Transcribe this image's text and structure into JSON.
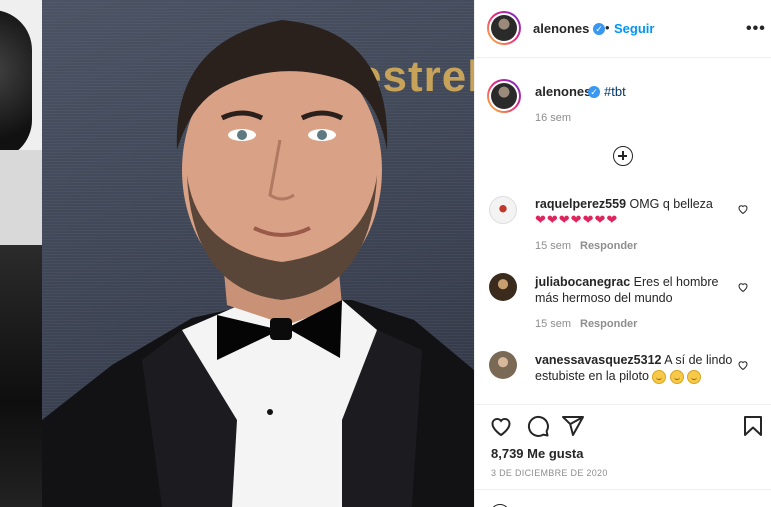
{
  "post": {
    "author": "alenones",
    "follow_label": "Seguir",
    "more_label": "•••",
    "caption_tag": "#tbt",
    "caption_age": "16 sem",
    "background_brand_text": "estrell",
    "likes": "8,739 Me gusta",
    "date": "3 DE DICIEMBRE DE 2020"
  },
  "comments": [
    {
      "user": "raquelperez559",
      "text": "OMG q belleza",
      "emoji_line": "❤❤❤❤❤❤❤",
      "age": "15 sem",
      "reply": "Responder"
    },
    {
      "user": "juliabocanegrac",
      "text": "Eres el hombre más hermoso del mundo",
      "age": "15 sem",
      "reply": "Responder"
    },
    {
      "user": "vanessavasquez5312",
      "text": "A sí de lindo estubiste en la piloto"
    }
  ],
  "icons": {
    "like": "heart-icon",
    "comment": "comment-icon",
    "share": "paper-plane-icon",
    "save": "bookmark-icon",
    "load_more": "plus-circle-icon",
    "verified": "verified-badge-icon"
  },
  "colors": {
    "link_blue": "#0095f6",
    "verified_blue": "#3897f0",
    "muted": "#8e8e8e",
    "heart_red": "#e0245e"
  }
}
